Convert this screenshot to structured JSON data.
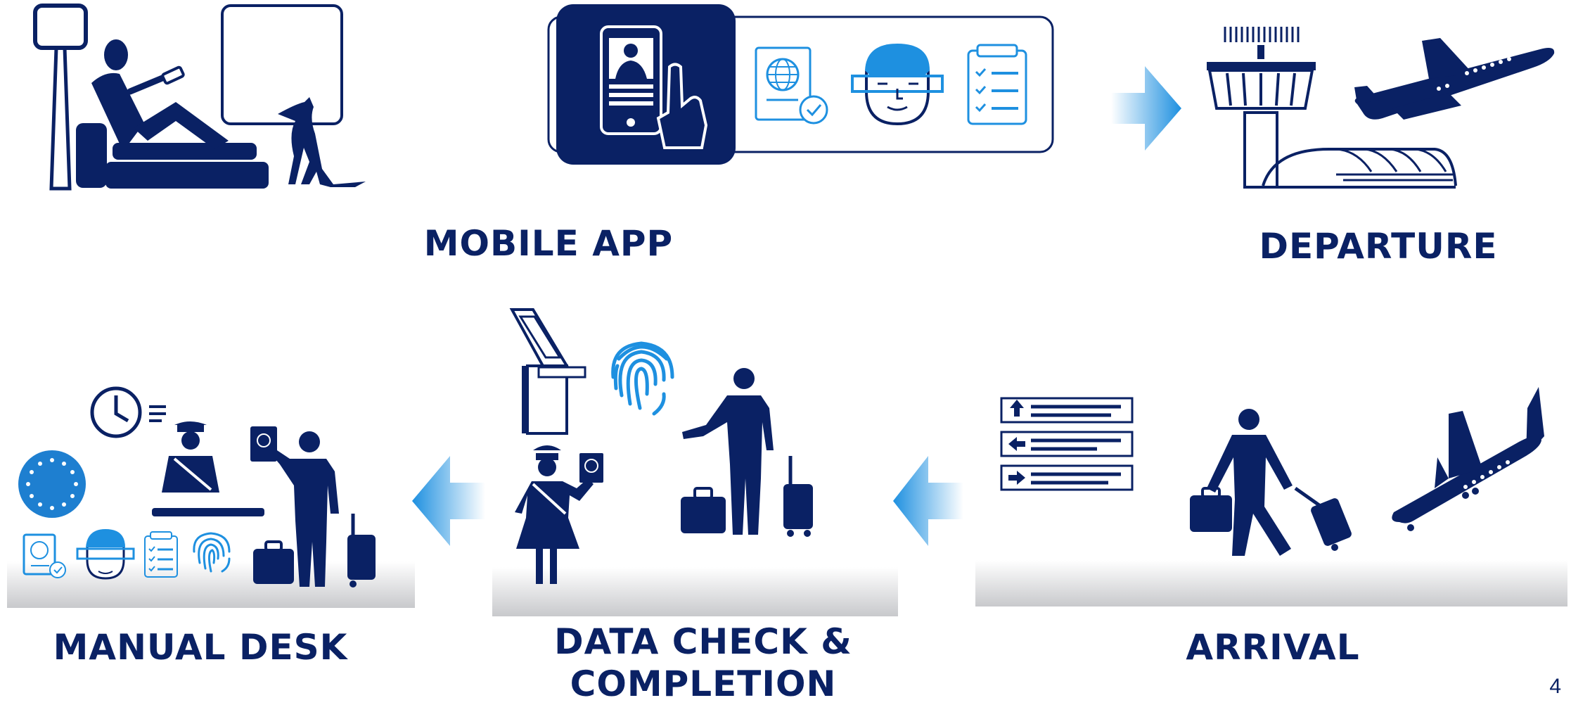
{
  "labels": {
    "mobile_app": "MOBILE APP",
    "departure": "DEPARTURE",
    "manual_desk": "MANUAL DESK",
    "data_check_line1": "DATA CHECK &",
    "data_check_line2": "COMPLETION",
    "arrival": "ARRIVAL"
  },
  "page_number": "4",
  "colors": {
    "navy": "#0a2164",
    "light_blue": "#1e90e0",
    "platform_gray": "#cfd0d3",
    "white": "#ffffff"
  },
  "icons": [
    "passenger-on-sofa-icon",
    "dog-icon",
    "smartphone-hand-icon",
    "passport-icon",
    "face-scan-icon",
    "checklist-icon",
    "control-tower-icon",
    "departing-plane-icon",
    "terminal-building-icon",
    "arrow-right-icon",
    "direction-signs-icon",
    "traveler-luggage-icon",
    "landing-plane-icon",
    "arrow-left-icon",
    "kiosk-icon",
    "fingerprint-icon",
    "border-officer-icon",
    "clock-icon",
    "eu-flag-icon"
  ]
}
